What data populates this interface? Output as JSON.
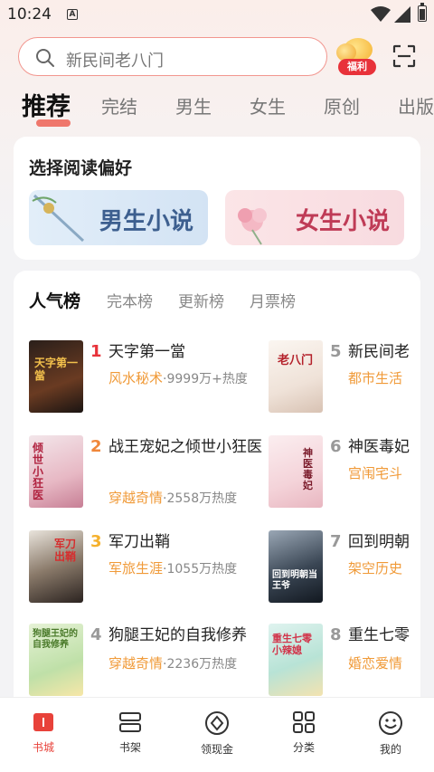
{
  "status": {
    "time": "10:24",
    "a_badge": "A"
  },
  "search": {
    "placeholder": "新民间老八门",
    "reward_tag": "福利"
  },
  "tabs": [
    "推荐",
    "完结",
    "男生",
    "女生",
    "原创",
    "出版"
  ],
  "preference": {
    "title": "选择阅读偏好",
    "male_label": "男生小说",
    "female_label": "女生小说"
  },
  "ranking": {
    "tabs": [
      "人气榜",
      "完本榜",
      "更新榜",
      "月票榜"
    ],
    "items": [
      {
        "rank": "1",
        "name": "天字第一當",
        "genre": "风水秘术",
        "heat": "·9999万+热度",
        "cover_text": "天字第一當"
      },
      {
        "rank": "2",
        "name": "战王宠妃之倾世小狂医",
        "genre": "穿越奇情",
        "heat": "·2558万热度",
        "cover_text": "倾世小狂医"
      },
      {
        "rank": "3",
        "name": "军刀出鞘",
        "genre": "军旅生涯",
        "heat": "·1055万热度",
        "cover_text": "军刀出鞘"
      },
      {
        "rank": "4",
        "name": "狗腿王妃的自我修养",
        "genre": "穿越奇情",
        "heat": "·2236万热度",
        "cover_text": "狗腿王妃的自我修养"
      },
      {
        "rank": "5",
        "name": "新民间老",
        "genre": "都市生活",
        "heat": "",
        "cover_text": "老八门"
      },
      {
        "rank": "6",
        "name": "神医毒妃",
        "genre": "宫闱宅斗",
        "heat": "",
        "cover_text": "神医毒妃"
      },
      {
        "rank": "7",
        "name": "回到明朝",
        "genre": "架空历史",
        "heat": "",
        "cover_text": "回到明朝当王爷"
      },
      {
        "rank": "8",
        "name": "重生七零",
        "genre": "婚恋爱情",
        "heat": "",
        "cover_text": "重生七零小辣媳"
      }
    ]
  },
  "bottom_nav": [
    "书城",
    "书架",
    "领现金",
    "分类",
    "我的"
  ],
  "colors": {
    "accent": "#e8423a",
    "genre": "#f09a38",
    "rank1": "#e8323a",
    "rank2": "#f0873a",
    "rank3": "#f5b12d",
    "rank_other": "#999999"
  }
}
